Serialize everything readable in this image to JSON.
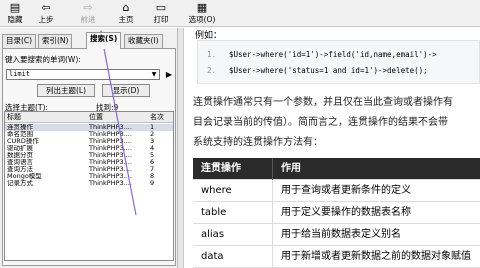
{
  "toolbar": {
    "buttons": [
      {
        "label": "隐藏",
        "icon": "hide-icon",
        "glyph": "▤"
      },
      {
        "label": "上步",
        "icon": "back-icon",
        "glyph": "⇦"
      },
      {
        "label": "前进",
        "icon": "forward-icon",
        "glyph": "⇨"
      },
      {
        "label": "主页",
        "icon": "home-icon",
        "glyph": "⌂"
      },
      {
        "label": "打印",
        "icon": "print-icon",
        "glyph": "▭"
      },
      {
        "label": "选项(O)",
        "icon": "options-icon",
        "glyph": "▦"
      }
    ]
  },
  "left": {
    "tabs": [
      "目录(C)",
      "索引(N)",
      "搜索(S)",
      "收藏夹(I)"
    ],
    "keyword_label": "键入要搜索的单词(W):",
    "keyword_value": "limit",
    "list_topics_button": "列出主题(L)",
    "display_button": "显示(D)",
    "select_topic_label": "选择主题(T):",
    "found_label": "找到:9",
    "columns": [
      "标题",
      "位置",
      "名次"
    ],
    "rows": [
      {
        "title": "连贯操作",
        "location": "ThinkPHP3....",
        "rank": "1"
      },
      {
        "title": "命名范围",
        "location": "ThinkPHP3....",
        "rank": "2"
      },
      {
        "title": "CURD操作",
        "location": "ThinkPHP3....",
        "rank": "3"
      },
      {
        "title": "驱动扩展",
        "location": "ThinkPHP3....",
        "rank": "4"
      },
      {
        "title": "数据分页",
        "location": "ThinkPHP3....",
        "rank": "5"
      },
      {
        "title": "查询语言",
        "location": "ThinkPHP3....",
        "rank": "6"
      },
      {
        "title": "查询方法",
        "location": "ThinkPHP3....",
        "rank": "7"
      },
      {
        "title": "Mongo模型",
        "location": "ThinkPHP3....",
        "rank": "8"
      },
      {
        "title": "记录方式",
        "location": "ThinkPHP3....",
        "rank": "9"
      }
    ]
  },
  "content": {
    "example_label": "例如：",
    "code": [
      {
        "num": "1.",
        "text": "$User->where('id=1')->field('id,name,email')->"
      },
      {
        "num": "2.",
        "text": "$User->where('status=1 and id=1')->delete();"
      }
    ],
    "paragraph_lines": [
      "连贯操作通常只有一个参数，并且仅在当此查询或者操作有",
      "目会记录当前的传值）。简而言之，连贯操作的结果不会带",
      "系统支持的连贯操作方法有："
    ],
    "table_header": [
      "连贯操作",
      "作用"
    ],
    "table_rows": [
      [
        "where",
        "用于查询或者更新条件的定义"
      ],
      [
        "table",
        "用于定义要操作的数据表名称"
      ],
      [
        "alias",
        "用于给当前数据表定义别名"
      ],
      [
        "data",
        "用于新增或者更新数据之前的数据对象赋值"
      ]
    ]
  },
  "colors": {
    "accent_arrow": "#8a6ad0",
    "selected_row": "#d8dcea"
  }
}
